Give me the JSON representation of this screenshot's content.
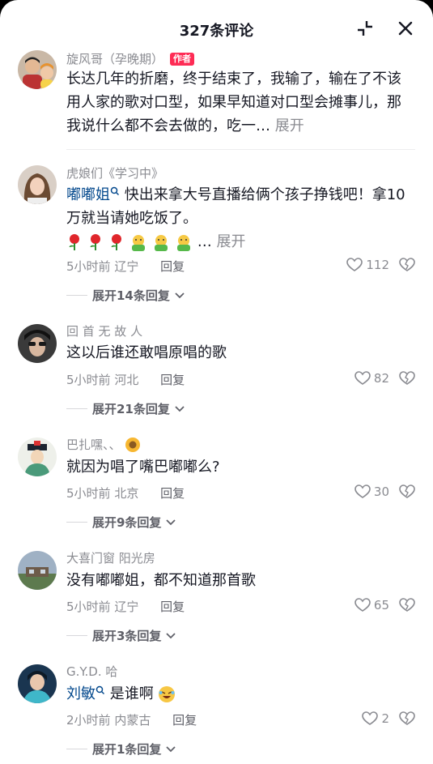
{
  "header": {
    "title": "327条评论"
  },
  "comments": [
    {
      "user": "旋风哥（孕晚期）",
      "author_tag": "作者",
      "text": "长达几年的折磨，终于结束了，我输了，输在了不该用人家的歌对口型，如果早知道对口型会摊事儿，那我说什么都不会去做的，吃一…",
      "more": "展开"
    },
    {
      "user": "虎娘们《学习中》",
      "mention": "嘟嘟姐",
      "text": "快出来拿大号直播给俩个孩子挣钱吧！拿10万就当请她吃饭了。",
      "ellipsis": "…",
      "more": "展开",
      "time": "5小时前",
      "location": "辽宁",
      "reply": "回复",
      "likes": "112",
      "expand": "展开14条回复"
    },
    {
      "user": "回 首 无 故 人",
      "text": "这以后谁还敢唱原唱的歌",
      "time": "5小时前",
      "location": "河北",
      "reply": "回复",
      "likes": "82",
      "expand": "展开21条回复"
    },
    {
      "user": "巴扎嘿、、",
      "text": "就因为唱了嘴巴嘟嘟么?",
      "time": "5小时前",
      "location": "北京",
      "reply": "回复",
      "likes": "30",
      "expand": "展开9条回复"
    },
    {
      "user": "大喜门窗  阳光房",
      "text": "没有嘟嘟姐，都不知道那首歌",
      "time": "5小时前",
      "location": "辽宁",
      "reply": "回复",
      "likes": "65",
      "expand": "展开3条回复"
    },
    {
      "user": "G.Y.D.  哈",
      "mention": "刘敏",
      "text": "是谁啊",
      "time": "2小时前",
      "location": "内蒙古",
      "reply": "回复",
      "likes": "2",
      "expand": "展开1条回复"
    }
  ],
  "icons": {
    "collapse": "collapse-arrows-icon",
    "close": "close-icon",
    "heart": "heart-outline-icon",
    "dislike": "broken-heart-icon",
    "chevron": "chevron-down-icon",
    "mention": "search-mention-icon"
  },
  "colors": {
    "author_tag": "#fe2c55",
    "mention": "#04498d",
    "muted": "#8a8b91"
  }
}
